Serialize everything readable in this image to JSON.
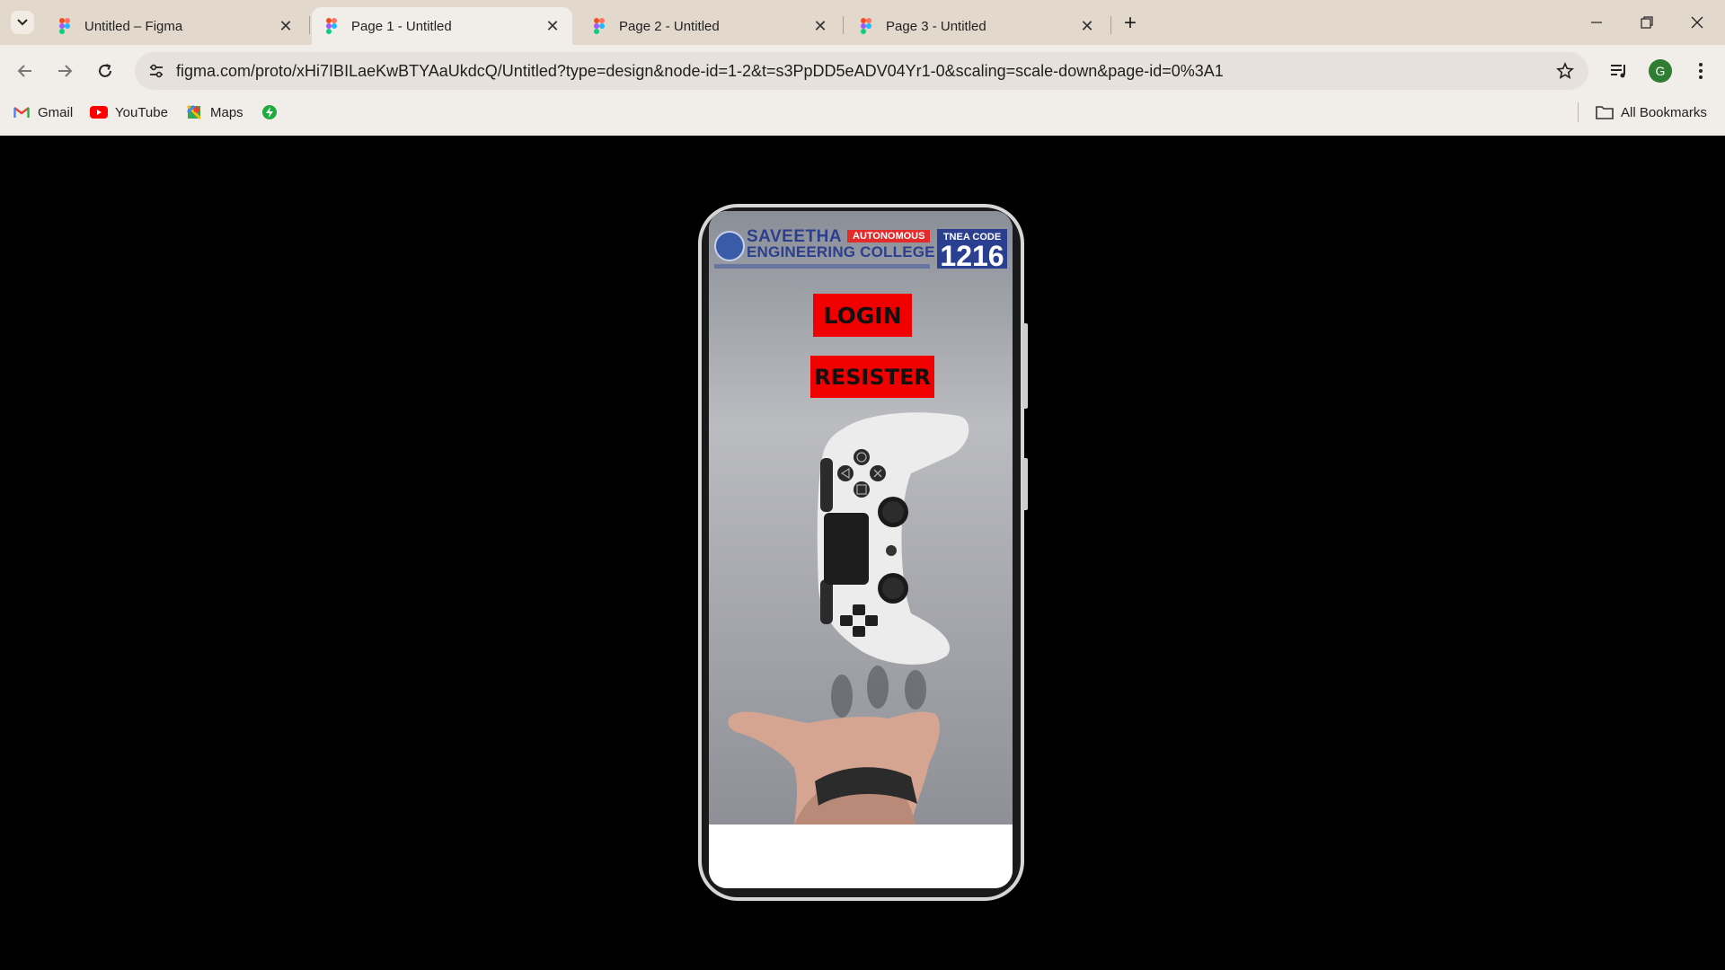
{
  "tabs": [
    {
      "title": "Untitled – Figma",
      "active": false
    },
    {
      "title": "Page 1 - Untitled",
      "active": true
    },
    {
      "title": "Page 2 - Untitled",
      "active": false
    },
    {
      "title": "Page 3 - Untitled",
      "active": false
    }
  ],
  "toolbar": {
    "url": "figma.com/proto/xHi7IBILaeKwBTYAaUkdcQ/Untitled?type=design&node-id=1-2&t=s3PpDD5eADV04Yr1-0&scaling=scale-down&page-id=0%3A1",
    "avatar_letter": "G"
  },
  "bookmarks": [
    {
      "label": "Gmail"
    },
    {
      "label": "YouTube"
    },
    {
      "label": "Maps"
    }
  ],
  "all_bookmarks_label": "All Bookmarks",
  "app": {
    "college_line1": "SAVEETHA",
    "college_line2": "ENGINEERING COLLEGE",
    "autonomous": "AUTONOMOUS",
    "tnea_label": "TNEA CODE",
    "tnea_code": "1216",
    "login_label": "LOGIN",
    "register_label": "RESISTER"
  },
  "colors": {
    "accent_red": "#f00000",
    "college_blue": "#2c3f8e"
  }
}
